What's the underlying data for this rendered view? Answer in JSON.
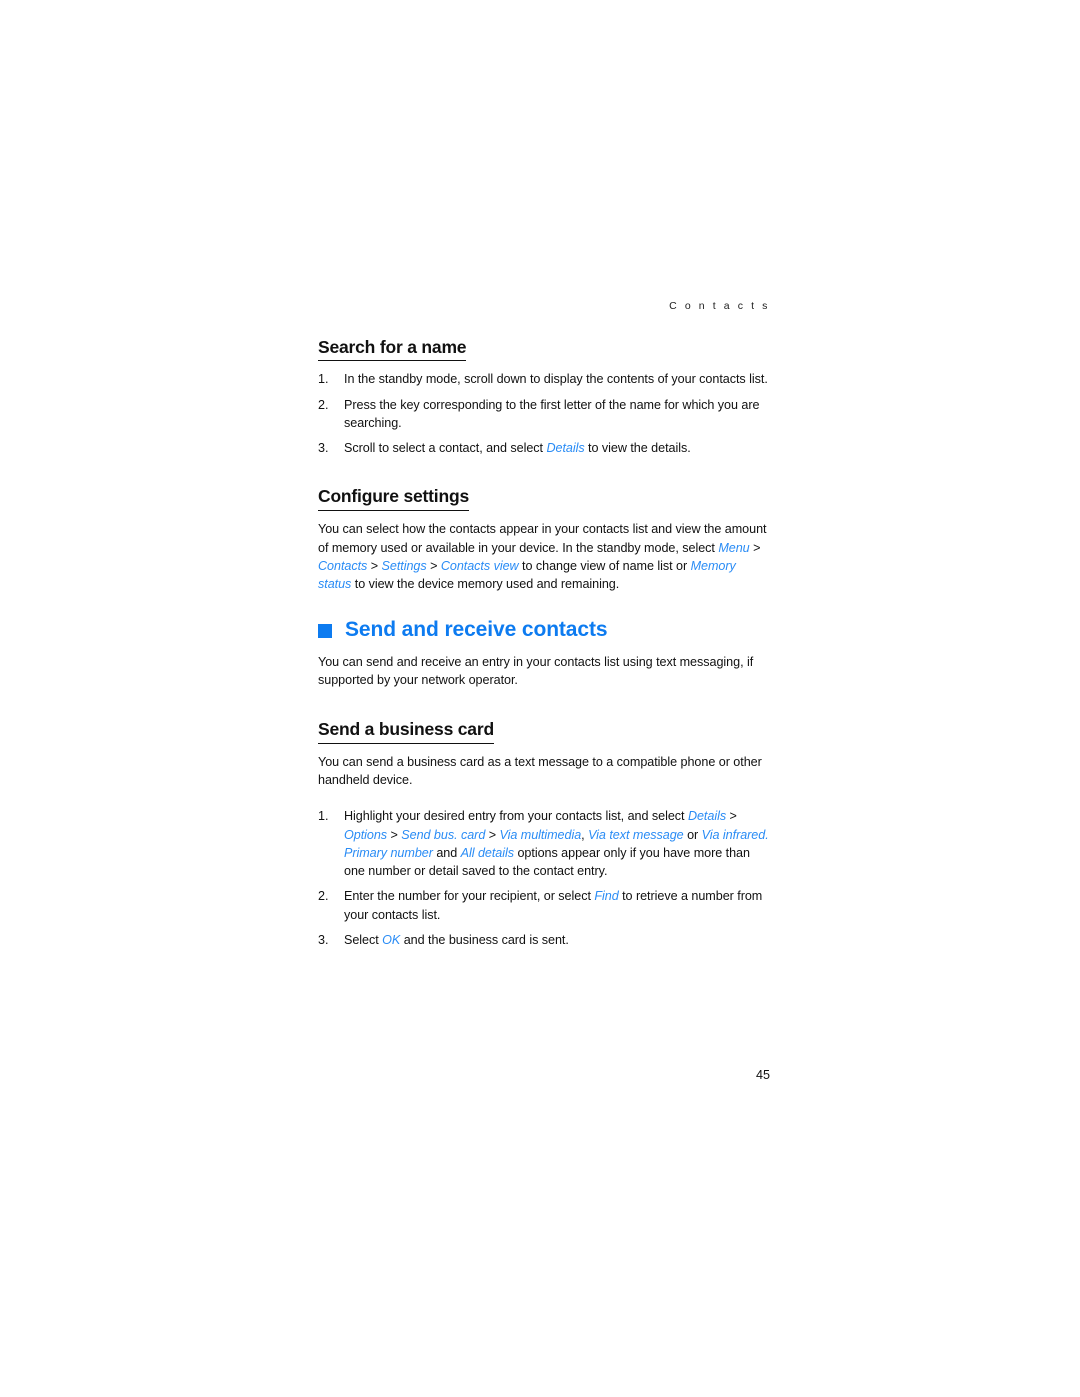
{
  "document": {
    "running_header": "C o n t a c t s",
    "page_number": "45",
    "accent_color": "#0d7bf0",
    "link_color": "#2a8cf5",
    "text_color": "#111111",
    "background": "#ffffff"
  },
  "sections": {
    "search_for_a_name": {
      "heading": "Search for a name",
      "steps": [
        {
          "number": "1.",
          "parts": [
            {
              "text": "In the standby mode, scroll down to display the contents of your contacts list.",
              "style": "plain"
            }
          ]
        },
        {
          "number": "2.",
          "parts": [
            {
              "text": "Press the key corresponding to the first letter of the name for which you are searching.",
              "style": "plain"
            }
          ]
        },
        {
          "number": "3.",
          "parts": [
            {
              "text": "Scroll to select a contact, and select ",
              "style": "plain"
            },
            {
              "text": "Details",
              "style": "ui"
            },
            {
              "text": " to view the details.",
              "style": "plain"
            }
          ]
        }
      ]
    },
    "configure_settings": {
      "heading": "Configure settings",
      "paragraph_parts": [
        {
          "text": "You can select how the contacts appear in your contacts list and view the amount of memory used or available in your device. In the standby mode, select ",
          "style": "plain"
        },
        {
          "text": "Menu",
          "style": "ui"
        },
        {
          "text": " > ",
          "style": "sep"
        },
        {
          "text": "Contacts",
          "style": "ui"
        },
        {
          "text": " > ",
          "style": "sep"
        },
        {
          "text": "Settings",
          "style": "ui"
        },
        {
          "text": " > ",
          "style": "sep"
        },
        {
          "text": "Contacts view",
          "style": "ui"
        },
        {
          "text": " to change view of name list or ",
          "style": "plain"
        },
        {
          "text": "Memory status",
          "style": "ui"
        },
        {
          "text": " to view the device memory used and remaining.",
          "style": "plain"
        }
      ]
    },
    "send_and_receive_contacts": {
      "heading": "Send and receive contacts",
      "bullet_icon": "filled-square-bullet-icon",
      "paragraph": "You can send and receive an entry in your contacts list using text messaging, if supported by your network operator."
    },
    "send_a_business_card": {
      "heading": "Send a business card",
      "paragraph": "You can send a business card as a text message to a compatible phone or other handheld device.",
      "steps": [
        {
          "number": "1.",
          "parts": [
            {
              "text": "Highlight your desired entry from your contacts list, and select ",
              "style": "plain"
            },
            {
              "text": "Details",
              "style": "ui"
            },
            {
              "text": " > ",
              "style": "sep"
            },
            {
              "text": "Options",
              "style": "ui"
            },
            {
              "text": " > ",
              "style": "sep"
            },
            {
              "text": "Send bus. card",
              "style": "ui"
            },
            {
              "text": " > ",
              "style": "sep"
            },
            {
              "text": "Via multimedia",
              "style": "ui"
            },
            {
              "text": ", ",
              "style": "sep"
            },
            {
              "text": "Via text message",
              "style": "ui"
            },
            {
              "text": " or ",
              "style": "plain"
            },
            {
              "text": "Via infrared.",
              "style": "ui"
            },
            {
              "text": " ",
              "style": "plain"
            },
            {
              "text": "Primary number",
              "style": "ui"
            },
            {
              "text": " and ",
              "style": "plain"
            },
            {
              "text": "All details",
              "style": "ui"
            },
            {
              "text": " options appear only if you have more than one number or detail saved to the contact entry.",
              "style": "plain"
            }
          ]
        },
        {
          "number": "2.",
          "parts": [
            {
              "text": "Enter the number for your recipient, or select ",
              "style": "plain"
            },
            {
              "text": "Find",
              "style": "ui"
            },
            {
              "text": " to retrieve a number from your contacts list.",
              "style": "plain"
            }
          ]
        },
        {
          "number": "3.",
          "parts": [
            {
              "text": "Select ",
              "style": "plain"
            },
            {
              "text": "OK",
              "style": "ui"
            },
            {
              "text": " and the business card is sent.",
              "style": "plain"
            }
          ]
        }
      ]
    }
  }
}
